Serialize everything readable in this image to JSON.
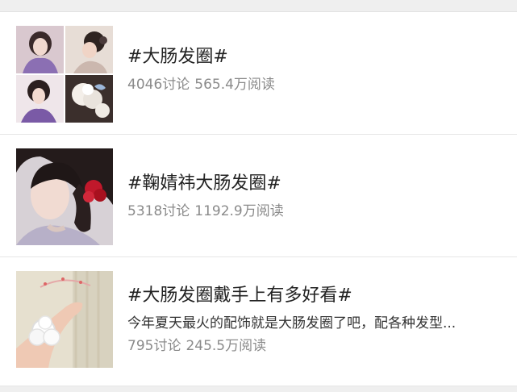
{
  "topics": [
    {
      "title": "#大肠发圈#",
      "description": "",
      "discussions": "4046讨论",
      "reads": "565.4万阅读",
      "thumbnail": "grid-4-photos"
    },
    {
      "title": "#鞠婧祎大肠发圈#",
      "description": "",
      "discussions": "5318讨论",
      "reads": "1192.9万阅读",
      "thumbnail": "portrait-red-scrunchie"
    },
    {
      "title": "#大肠发圈戴手上有多好看#",
      "description": "今年夏天最火的配饰就是大肠发圈了吧，配各种发型...",
      "discussions": "795讨论",
      "reads": "245.5万阅读",
      "thumbnail": "wrist-white-scrunchie"
    }
  ],
  "colors": {
    "background": "#efefef",
    "card": "#ffffff",
    "title": "#222222",
    "meta": "#8a8a8a",
    "scrunchie_red": "#c0182b"
  }
}
